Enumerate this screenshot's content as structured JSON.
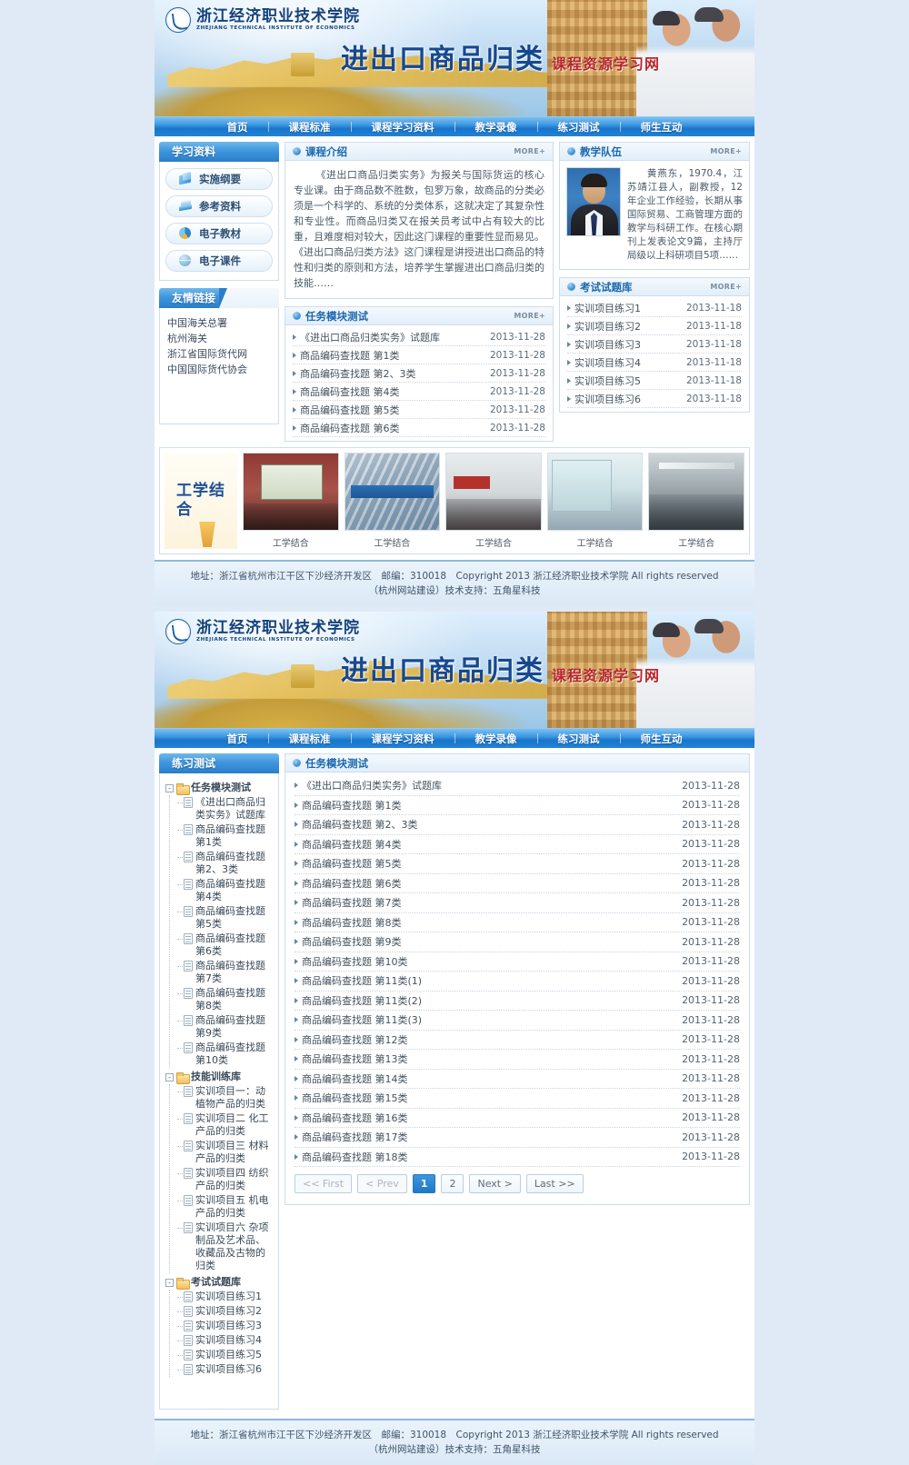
{
  "site": {
    "logo_cn": "浙江经济职业技术学院",
    "logo_en": "ZHEJIANG TECHNICAL INSTITUTE OF ECONOMICS",
    "banner_title": "进出口商品归类",
    "banner_subtitle": "课程资源学习网"
  },
  "nav": {
    "items": [
      {
        "label": "首页"
      },
      {
        "label": "课程标准"
      },
      {
        "label": "课程学习资料"
      },
      {
        "label": "教学录像"
      },
      {
        "label": "练习测试"
      },
      {
        "label": "师生互动"
      }
    ]
  },
  "sidebar": {
    "study_materials": {
      "title": "学习资料",
      "buttons": [
        {
          "label": "实施纲要",
          "icon": "outline-icon"
        },
        {
          "label": "参考资料",
          "icon": "books-icon"
        },
        {
          "label": "电子教材",
          "icon": "pie-icon"
        },
        {
          "label": "电子课件",
          "icon": "globe-icon"
        }
      ]
    },
    "friendly_links": {
      "title": "友情链接",
      "items": [
        {
          "label": "中国海关总署"
        },
        {
          "label": "杭州海关"
        },
        {
          "label": "浙江省国际货代网"
        },
        {
          "label": "中国国际货代协会"
        }
      ]
    }
  },
  "intro": {
    "title": "课程介绍",
    "more": "MORE+",
    "text": "《进出口商品归类实务》为报关与国际货运的核心专业课。由于商品数不胜数，包罗万象，故商品的分类必须是一个科学的、系统的分类体系，这就决定了其复杂性和专业性。而商品归类又在报关员考试中占有较大的比重，且难度相对较大，因此这门课程的重要性显而易见。《进出口商品归类方法》这门课程是讲授进出口商品的特性和归类的原则和方法，培养学生掌握进出口商品归类的技能……"
  },
  "teacher": {
    "title": "教学队伍",
    "more": "MORE+",
    "text": "黄燕东，1970.4，江苏靖江县人，副教授，12年企业工作经验，长期从事国际贸易、工商管理方面的教学与科研工作。在核心期刊上发表论文9篇，主持厅局级以上科研项目5项……"
  },
  "task_panel": {
    "title": "任务模块测试",
    "more": "MORE+",
    "rows": [
      {
        "title": "《进出口商品归类实务》试题库",
        "date": "2013-11-28"
      },
      {
        "title": "商品编码查找题 第1类",
        "date": "2013-11-28"
      },
      {
        "title": "商品编码查找题 第2、3类",
        "date": "2013-11-28"
      },
      {
        "title": "商品编码查找题 第4类",
        "date": "2013-11-28"
      },
      {
        "title": "商品编码查找题 第5类",
        "date": "2013-11-28"
      },
      {
        "title": "商品编码查找题 第6类",
        "date": "2013-11-28"
      }
    ]
  },
  "exam_panel": {
    "title": "考试试题库",
    "more": "MORE+",
    "rows": [
      {
        "title": "实训项目练习1",
        "date": "2013-11-18"
      },
      {
        "title": "实训项目练习2",
        "date": "2013-11-18"
      },
      {
        "title": "实训项目练习3",
        "date": "2013-11-18"
      },
      {
        "title": "实训项目练习4",
        "date": "2013-11-18"
      },
      {
        "title": "实训项目练习5",
        "date": "2013-11-18"
      },
      {
        "title": "实训项目练习6",
        "date": "2013-11-18"
      }
    ]
  },
  "gallery": {
    "cover_text": "工学结合",
    "items": [
      {
        "caption": "工学结合"
      },
      {
        "caption": "工学结合"
      },
      {
        "caption": "工学结合"
      },
      {
        "caption": "工学结合"
      },
      {
        "caption": "工学结合"
      }
    ]
  },
  "footer": {
    "line1": "地址：浙江省杭州市江干区下沙经济开发区　邮编：310018　Copyright 2013 浙江经济职业技术学院 All rights reserved",
    "line2": "（杭州网站建设）技术支持：五角星科技"
  },
  "page2": {
    "sidebar_title": "练习测试",
    "tree": [
      {
        "label": "任务模块测试",
        "toggle": "-",
        "children": [
          {
            "label": "《进出口商品归类实务》试题库"
          },
          {
            "label": "商品编码查找题 第1类"
          },
          {
            "label": "商品编码查找题 第2、3类"
          },
          {
            "label": "商品编码查找题 第4类"
          },
          {
            "label": "商品编码查找题 第5类"
          },
          {
            "label": "商品编码查找题 第6类"
          },
          {
            "label": "商品编码查找题 第7类"
          },
          {
            "label": "商品编码查找题 第8类"
          },
          {
            "label": "商品编码查找题 第9类"
          },
          {
            "label": "商品编码查找题 第10类"
          }
        ]
      },
      {
        "label": "技能训练库",
        "toggle": "-",
        "children": [
          {
            "label": "实训项目一：动植物产品的归类"
          },
          {
            "label": "实训项目二 化工产品的归类"
          },
          {
            "label": "实训项目三 材料产品的归类"
          },
          {
            "label": "实训项目四 纺织产品的归类"
          },
          {
            "label": "实训项目五 机电产品的归类"
          },
          {
            "label": "实训项目六 杂项制品及艺术品、收藏品及古物的归类"
          }
        ]
      },
      {
        "label": "考试试题库",
        "toggle": "-",
        "children": [
          {
            "label": "实训项目练习1"
          },
          {
            "label": "实训项目练习2"
          },
          {
            "label": "实训项目练习3"
          },
          {
            "label": "实训项目练习4"
          },
          {
            "label": "实训项目练习5"
          },
          {
            "label": "实训项目练习6"
          }
        ]
      }
    ],
    "main_title": "任务模块测试",
    "rows": [
      {
        "title": "《进出口商品归类实务》试题库",
        "date": "2013-11-28"
      },
      {
        "title": "商品编码查找题 第1类",
        "date": "2013-11-28"
      },
      {
        "title": "商品编码查找题 第2、3类",
        "date": "2013-11-28"
      },
      {
        "title": "商品编码查找题 第4类",
        "date": "2013-11-28"
      },
      {
        "title": "商品编码查找题 第5类",
        "date": "2013-11-28"
      },
      {
        "title": "商品编码查找题 第6类",
        "date": "2013-11-28"
      },
      {
        "title": "商品编码查找题 第7类",
        "date": "2013-11-28"
      },
      {
        "title": "商品编码查找题 第8类",
        "date": "2013-11-28"
      },
      {
        "title": "商品编码查找题 第9类",
        "date": "2013-11-28"
      },
      {
        "title": "商品编码查找题 第10类",
        "date": "2013-11-28"
      },
      {
        "title": "商品编码查找题 第11类(1)",
        "date": "2013-11-28"
      },
      {
        "title": "商品编码查找题 第11类(2)",
        "date": "2013-11-28"
      },
      {
        "title": "商品编码查找题 第11类(3)",
        "date": "2013-11-28"
      },
      {
        "title": "商品编码查找题 第12类",
        "date": "2013-11-28"
      },
      {
        "title": "商品编码查找题 第13类",
        "date": "2013-11-28"
      },
      {
        "title": "商品编码查找题 第14类",
        "date": "2013-11-28"
      },
      {
        "title": "商品编码查找题 第15类",
        "date": "2013-11-28"
      },
      {
        "title": "商品编码查找题 第16类",
        "date": "2013-11-28"
      },
      {
        "title": "商品编码查找题 第17类",
        "date": "2013-11-28"
      },
      {
        "title": "商品编码查找题 第18类",
        "date": "2013-11-28"
      }
    ],
    "pager": {
      "first": "<< First",
      "prev": "< Prev",
      "pages": [
        {
          "label": "1",
          "active": true
        },
        {
          "label": "2",
          "active": false
        }
      ],
      "next": "Next >",
      "last": "Last >>"
    }
  },
  "colors": {
    "accent_blue": "#1f78c8",
    "title_blue": "#16488f",
    "subtitle_red": "#b8252b",
    "panel_border": "#cfdded",
    "page_bg": "#dfeaf6"
  }
}
